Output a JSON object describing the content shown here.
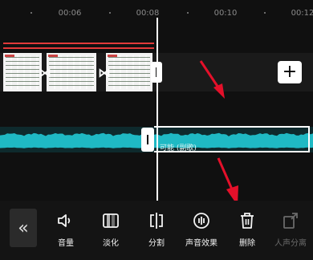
{
  "ruler": {
    "ticks": [
      "00:06",
      "00:08",
      "00:10",
      "00:12"
    ]
  },
  "audio": {
    "clip_label": "可能 (副歌)",
    "color": "#1fb9c4"
  },
  "colors": {
    "accent": "#e4102a",
    "audio_wave": "#1fb9c4",
    "trim_line": "#e23a3a"
  },
  "timeline": {
    "add_icon": "plus-icon",
    "transition_icon": "bowtie-icon"
  },
  "toolbar": {
    "back_icon": "double-chevron-left-icon",
    "tools": [
      {
        "label": "音量",
        "icon": "speaker-icon",
        "enabled": true
      },
      {
        "label": "淡化",
        "icon": "fade-icon",
        "enabled": true
      },
      {
        "label": "分割",
        "icon": "split-icon",
        "enabled": true
      },
      {
        "label": "声音效果",
        "icon": "voice-effect-icon",
        "enabled": true
      },
      {
        "label": "删除",
        "icon": "trash-icon",
        "enabled": true
      },
      {
        "label": "人声分离",
        "icon": "vocal-separate-icon",
        "enabled": false
      }
    ]
  }
}
